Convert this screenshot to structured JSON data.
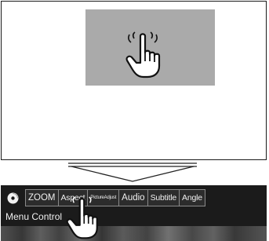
{
  "top_panel": {
    "touch_area_color": "#aaaaaa",
    "hand_icon": "pointing-hand-icon"
  },
  "arrow": {
    "icon": "down-arrow-icon"
  },
  "menu_bar": {
    "disc_icon": "disc-icon",
    "tabs": [
      {
        "label": "ZOOM"
      },
      {
        "label": "Aspect"
      },
      {
        "label": "PictureAdjust"
      },
      {
        "label": "Audio"
      },
      {
        "label": "Subtitle"
      },
      {
        "label": "Angle"
      }
    ],
    "menu_label": "Menu Control",
    "hand_icon": "pointing-hand-icon"
  }
}
